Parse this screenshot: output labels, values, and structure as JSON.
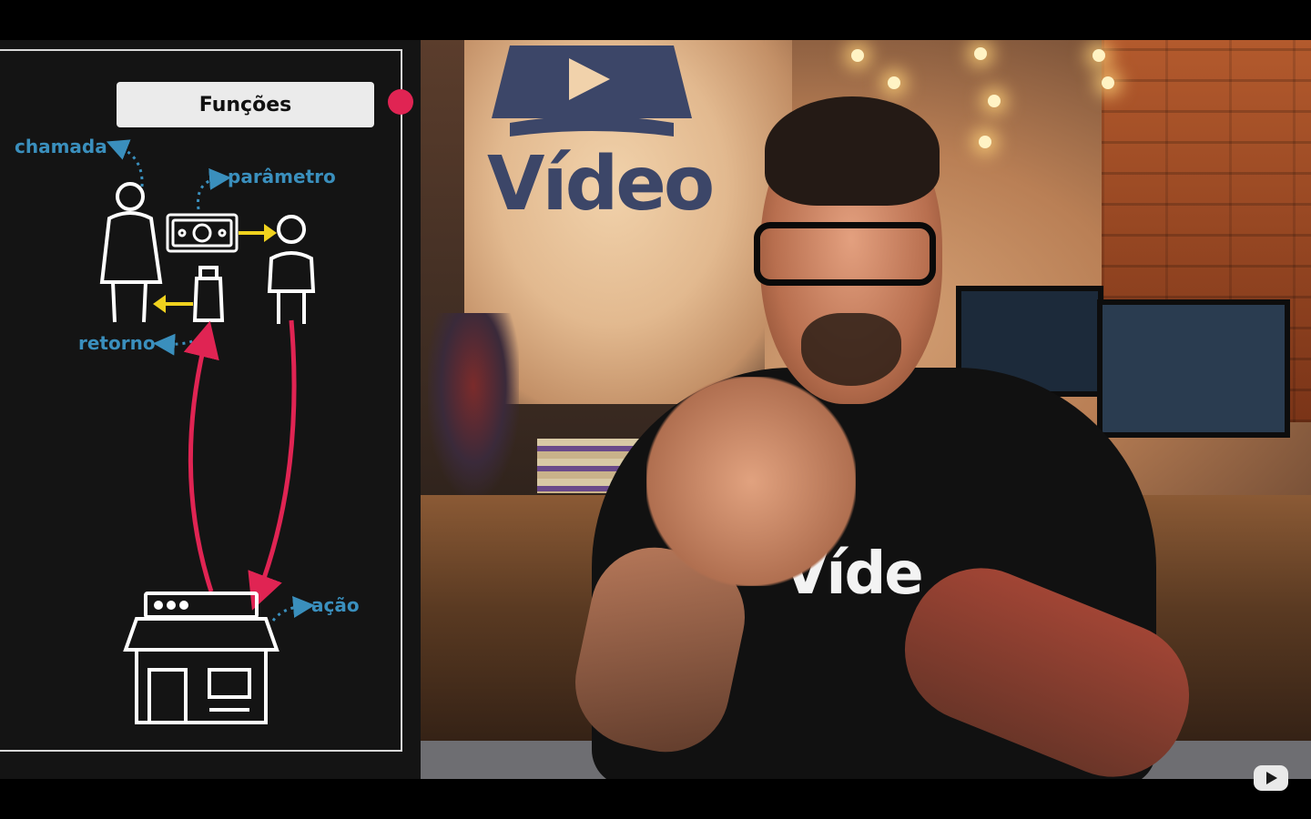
{
  "diagram": {
    "title": "Funções",
    "labels": {
      "chamada": "chamada",
      "parametro": "parâmetro",
      "retorno": "retorno",
      "acao": "ação"
    },
    "icons": [
      "woman-icon",
      "money-icon",
      "child-icon",
      "milk-bottle-icon",
      "store-icon"
    ],
    "colors": {
      "label": "#3a8fbd",
      "arrow_red": "#e02453",
      "arrow_yellow": "#f0d21e",
      "record": "#e02453"
    }
  },
  "background": {
    "brand_text": "Vídeo",
    "shirt_text": "Víde"
  },
  "player": {
    "logo": "youtube-logo-icon"
  }
}
